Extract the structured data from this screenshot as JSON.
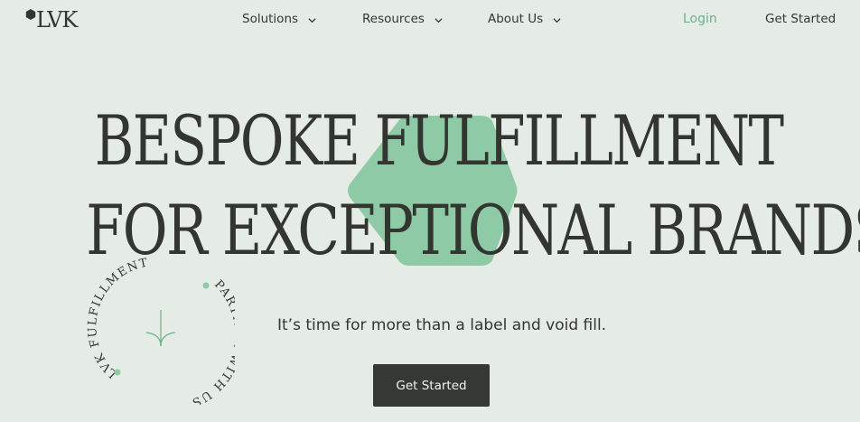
{
  "brand": {
    "logo_text": "LVK",
    "accent": "#6bb28b",
    "dark": "#363933",
    "background": "#e5ebe5",
    "shape_color": "#8ecaa6"
  },
  "nav": {
    "items": [
      {
        "label": "Solutions"
      },
      {
        "label": "Resources"
      },
      {
        "label": "About Us"
      }
    ],
    "login_label": "Login",
    "cta_label": "Get Started"
  },
  "hero": {
    "headline_line1": "BESPOKE FULFILLMENT",
    "headline_line2": "FOR EXCEPTIONAL BRANDS",
    "subtitle": "It’s time for more than a label and void fill.",
    "cta_label": "Get Started"
  },
  "badge": {
    "text_top": "LVK FULFILLMENT",
    "text_bottom": "PARTNER WITH US",
    "icon": "arrow-down-icon"
  }
}
